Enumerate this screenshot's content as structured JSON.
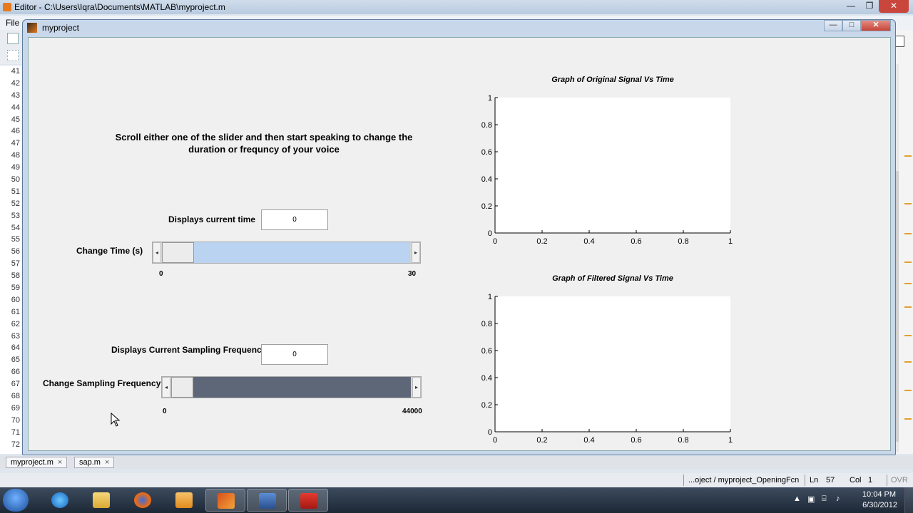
{
  "editor": {
    "title": "Editor - C:\\Users\\Iqra\\Documents\\MATLAB\\myproject.m",
    "menu_file": "File",
    "line_numbers": [
      "41",
      "42",
      "43",
      "44",
      "45",
      "46",
      "47",
      "48",
      "49",
      "50",
      "51",
      "52",
      "53",
      "54",
      "55",
      "56",
      "57",
      "58",
      "59",
      "60",
      "61",
      "62",
      "63",
      "64",
      "65",
      "66",
      "67",
      "68",
      "69",
      "70",
      "71",
      "72"
    ],
    "tabs": [
      {
        "label": "myproject.m",
        "close": "×"
      },
      {
        "label": "sap.m",
        "close": "×"
      }
    ],
    "status": {
      "function": "...oject / myproject_OpeningFcn",
      "ln_label": "Ln",
      "ln": "57",
      "col_label": "Col",
      "col": "1",
      "mode": "OVR"
    }
  },
  "figure": {
    "title": "myproject",
    "instructions": "Scroll either one of the slider and then start speaking to change the duration or frequncy of your voice",
    "time_display_label": "Displays current time",
    "time_display_value": "0",
    "time_slider_label": "Change Time (s)",
    "time_slider": {
      "min_label": "0",
      "max_label": "30",
      "value_fraction": 0
    },
    "freq_display_label": "Displays Current Sampling Frequency",
    "freq_display_value": "0",
    "freq_slider_label": "Change Sampling Frequency",
    "freq_slider": {
      "min_label": "0",
      "max_label": "44000",
      "value_fraction": 0
    },
    "colors": {
      "time_track": "#b9d3f0",
      "freq_track": "#5d6778"
    }
  },
  "chart_data": [
    {
      "type": "line",
      "title": "Graph of Original Signal Vs Time",
      "xlim": [
        0,
        1
      ],
      "ylim": [
        0,
        1
      ],
      "xticks": [
        "0",
        "0.2",
        "0.4",
        "0.6",
        "0.8",
        "1"
      ],
      "yticks": [
        "0",
        "0.2",
        "0.4",
        "0.6",
        "0.8",
        "1"
      ],
      "series": []
    },
    {
      "type": "line",
      "title": "Graph of Filtered Signal Vs Time",
      "xlim": [
        0,
        1
      ],
      "ylim": [
        0,
        1
      ],
      "xticks": [
        "0",
        "0.2",
        "0.4",
        "0.6",
        "0.8",
        "1"
      ],
      "yticks": [
        "0",
        "0.2",
        "0.4",
        "0.6",
        "0.8",
        "1"
      ],
      "series": []
    }
  ],
  "taskbar": {
    "apps": [
      "windows-explorer",
      "internet-explorer",
      "file-manager",
      "firefox",
      "media-player",
      "matlab",
      "floppy-app",
      "pdf-reader"
    ],
    "clock_time": "10:04 PM",
    "clock_date": "6/30/2012"
  }
}
